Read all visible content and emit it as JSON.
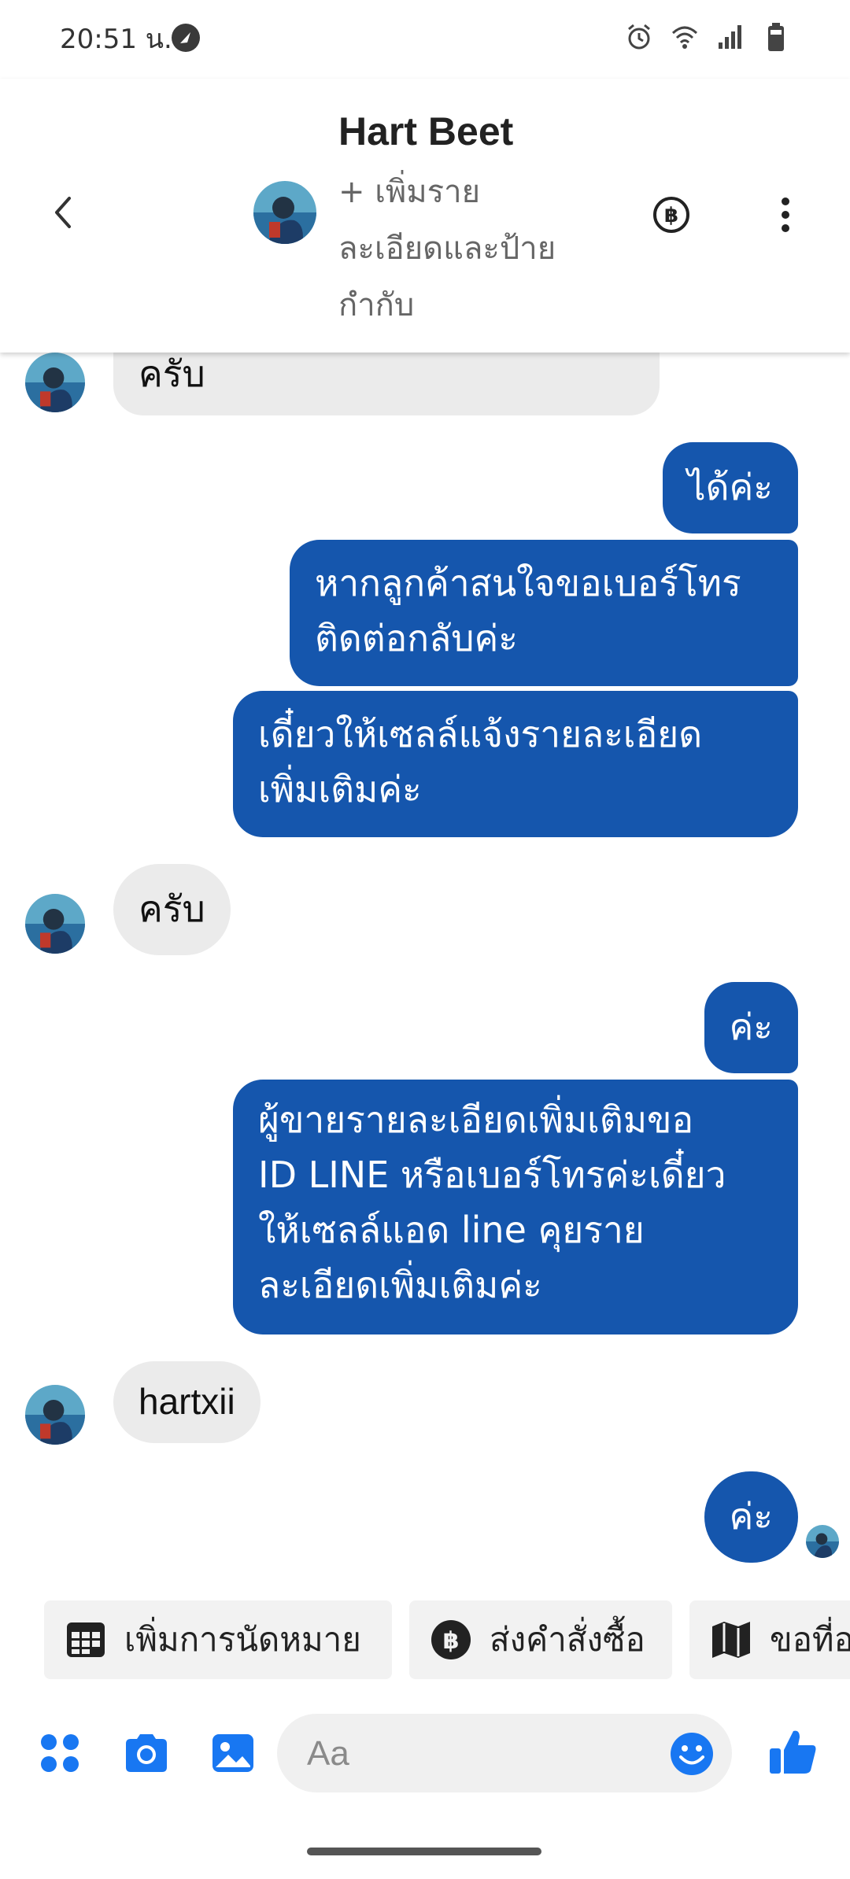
{
  "status_bar": {
    "time": "20:51 น.",
    "icons": [
      "navigation-icon",
      "alarm-icon",
      "wifi-icon",
      "signal-icon",
      "battery-icon"
    ]
  },
  "header": {
    "contact_name": "Hart Beet",
    "add_details": "+ เพิ่มราย\nละเอียดและป้าย\nกำกับ",
    "icons": [
      "back-icon",
      "baht-icon",
      "more-icon"
    ]
  },
  "messages": [
    {
      "side": "in",
      "text": "ครับ"
    },
    {
      "side": "out",
      "text": "ได้ค่ะ"
    },
    {
      "side": "out",
      "text": "หากลูกค้าสนใจขอเบอร์โทร\nติดต่อกลับค่ะ"
    },
    {
      "side": "out",
      "text": "เดี๋ยวให้เซลล์แจ้งรายละเอียด\nเพิ่มเติมค่ะ"
    },
    {
      "side": "in",
      "text": "ครับ"
    },
    {
      "side": "out",
      "text": "ค่ะ"
    },
    {
      "side": "out",
      "text": "ผู้ขายรายละเอียดเพิ่มเติมขอ\nID LINE หรือเบอร์โทรค่ะเดี๋ยว\nให้เซลล์แอด line คุยราย\nละเอียดเพิ่มเติมค่ะ"
    },
    {
      "side": "in",
      "text": "hartxii"
    },
    {
      "side": "out",
      "text": "ค่ะ"
    }
  ],
  "quick_replies": [
    {
      "label": "เพิ่มการนัดหมาย",
      "icon": "calendar-icon"
    },
    {
      "label": "ส่งคำสั่งซื้อ",
      "icon": "baht-icon"
    },
    {
      "label": "ขอที่อ",
      "icon": "map-icon"
    }
  ],
  "composer": {
    "placeholder": "Aa",
    "icons": [
      "apps-icon",
      "camera-icon",
      "gallery-icon",
      "emoji-icon",
      "like-icon"
    ]
  },
  "colors": {
    "outgoing_bubble": "#1556ad",
    "incoming_bubble": "#ebebeb",
    "accent": "#1877f2"
  }
}
